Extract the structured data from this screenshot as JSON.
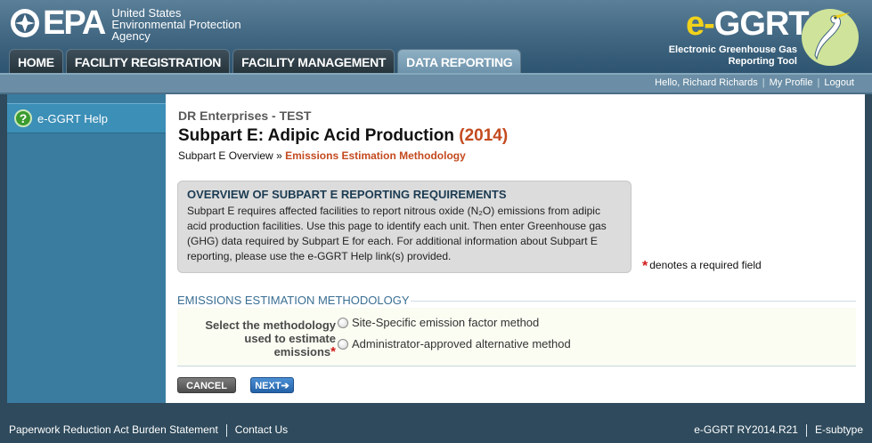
{
  "header": {
    "epa_letters": "EPA",
    "agency_line1": "United States",
    "agency_line2": "Environmental Protection",
    "agency_line3": "Agency",
    "app_title_e": "e-",
    "app_title_rest": "GGRT",
    "app_subtitle_line1": "Electronic Greenhouse Gas",
    "app_subtitle_line2": "Reporting Tool"
  },
  "tabs": [
    {
      "label": "HOME",
      "active": false
    },
    {
      "label": "FACILITY REGISTRATION",
      "active": false
    },
    {
      "label": "FACILITY MANAGEMENT",
      "active": false
    },
    {
      "label": "DATA REPORTING",
      "active": true
    }
  ],
  "userbar": {
    "greeting": "Hello, Richard Richards",
    "separator": "|",
    "my_profile": "My Profile",
    "logout": "Logout"
  },
  "sidebar": {
    "help_icon_glyph": "?",
    "help_label": "e-GGRT Help"
  },
  "main": {
    "company": "DR Enterprises - TEST",
    "title": "Subpart E: Adipic Acid Production",
    "year": "(2014)",
    "breadcrumb_parent": "Subpart E Overview",
    "breadcrumb_sep": "»",
    "breadcrumb_current": "Emissions Estimation Methodology",
    "overview_title": "OVERVIEW OF SUBPART E REPORTING REQUIREMENTS",
    "overview_body": "Subpart E requires affected facilities to report nitrous oxide (N₂O) emissions from adipic acid production facilities. Use this page to identify each unit. Then enter Greenhouse gas (GHG) data required by Subpart E for each. For additional information about Subpart E reporting, please use the e-GGRT Help link(s) provided.",
    "required_star": "*",
    "required_text": "denotes a required field",
    "section_title": "EMISSIONS ESTIMATION METHODOLOGY",
    "field_label": "Select the methodology used to estimate emissions",
    "field_star": "*",
    "options": [
      {
        "label": "Site-Specific emission factor method",
        "selected": false
      },
      {
        "label": "Administrator-approved alternative method",
        "selected": false
      }
    ],
    "cancel_label": "CANCEL",
    "next_label": "NEXT➔"
  },
  "footer": {
    "paperwork": "Paperwork Reduction Act Burden Statement",
    "contact": "Contact Us",
    "version": "e-GGRT RY2014.R21",
    "subtype": "E-subtype"
  },
  "colors": {
    "header_bg": "#3f6580",
    "sidebar_bg": "#3a7ca0",
    "accent_orange": "#c44a1f",
    "required_red": "#d01a1a",
    "next_blue": "#2462a8"
  }
}
